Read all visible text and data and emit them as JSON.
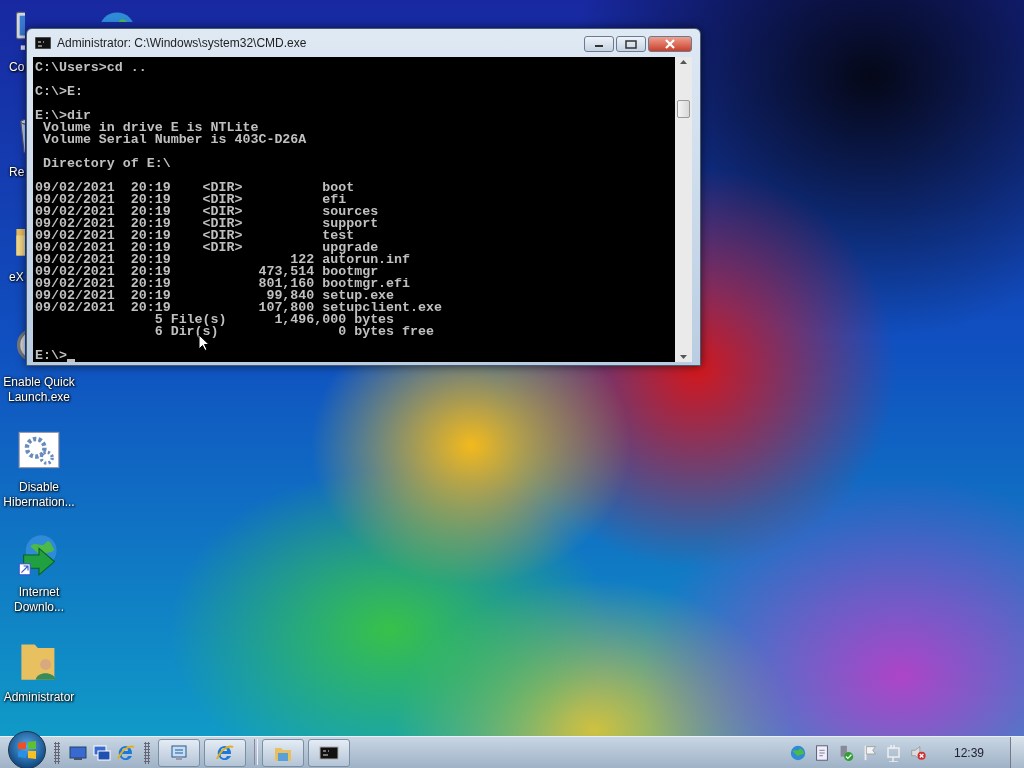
{
  "desktop_columns": [
    [
      {
        "kind": "computer",
        "label": "Co",
        "icon_covered": true,
        "label_covered": true
      },
      {
        "kind": "recycle",
        "label": "Re",
        "icon_covered": true,
        "label_covered": true
      },
      {
        "kind": "folder",
        "label": "eX",
        "icon_covered": true,
        "label_covered": true
      },
      {
        "kind": "app",
        "label": "Enable Quick Launch.exe",
        "icon_covered": true,
        "label_covered": false
      },
      {
        "kind": "gear",
        "label": "Disable Hibernation...",
        "icon_covered": false,
        "label_covered": false
      },
      {
        "kind": "download",
        "label": "Internet Downlo...",
        "icon_covered": false,
        "label_covered": false
      },
      {
        "kind": "user-folder",
        "label": "Administrator",
        "icon_covered": false,
        "label_covered": false
      }
    ],
    [
      {
        "kind": "network",
        "icon_covered": true
      }
    ]
  ],
  "window": {
    "title": "Administrator: C:\\Windows\\system32\\CMD.exe",
    "console_blocks": [
      [
        "C:\\Users>cd .."
      ],
      [
        "C:\\>E:"
      ],
      [
        "E:\\>dir",
        " Volume in drive E is NTLite",
        " Volume Serial Number is 403C-D26A"
      ],
      [
        " Directory of E:\\"
      ],
      [
        "09/02/2021  20:19    <DIR>          boot",
        "09/02/2021  20:19    <DIR>          efi",
        "09/02/2021  20:19    <DIR>          sources",
        "09/02/2021  20:19    <DIR>          support",
        "09/02/2021  20:19    <DIR>          test",
        "09/02/2021  20:19    <DIR>          upgrade",
        "09/02/2021  20:19               122 autorun.inf",
        "09/02/2021  20:19           473,514 bootmgr",
        "09/02/2021  20:19           801,160 bootmgr.efi",
        "09/02/2021  20:19            99,840 setup.exe",
        "09/02/2021  20:19           107,800 setupclient.exe",
        "               5 File(s)      1,496,000 bytes",
        "               6 Dir(s)               0 bytes free"
      ]
    ],
    "prompt": "E:\\>"
  },
  "taskbar": {
    "quick_launch": [
      {
        "kind": "desktop"
      },
      {
        "kind": "switch"
      },
      {
        "kind": "ie"
      }
    ],
    "buttons": [
      {
        "kind": "remote"
      },
      {
        "kind": "ie"
      },
      {
        "kind": "explorer"
      },
      {
        "kind": "cmd"
      }
    ],
    "tray": [
      {
        "kind": "globe"
      },
      {
        "kind": "note"
      },
      {
        "kind": "safe-remove"
      },
      {
        "kind": "flag"
      },
      {
        "kind": "network"
      },
      {
        "kind": "speaker-muted"
      }
    ],
    "clock": "12:39"
  }
}
